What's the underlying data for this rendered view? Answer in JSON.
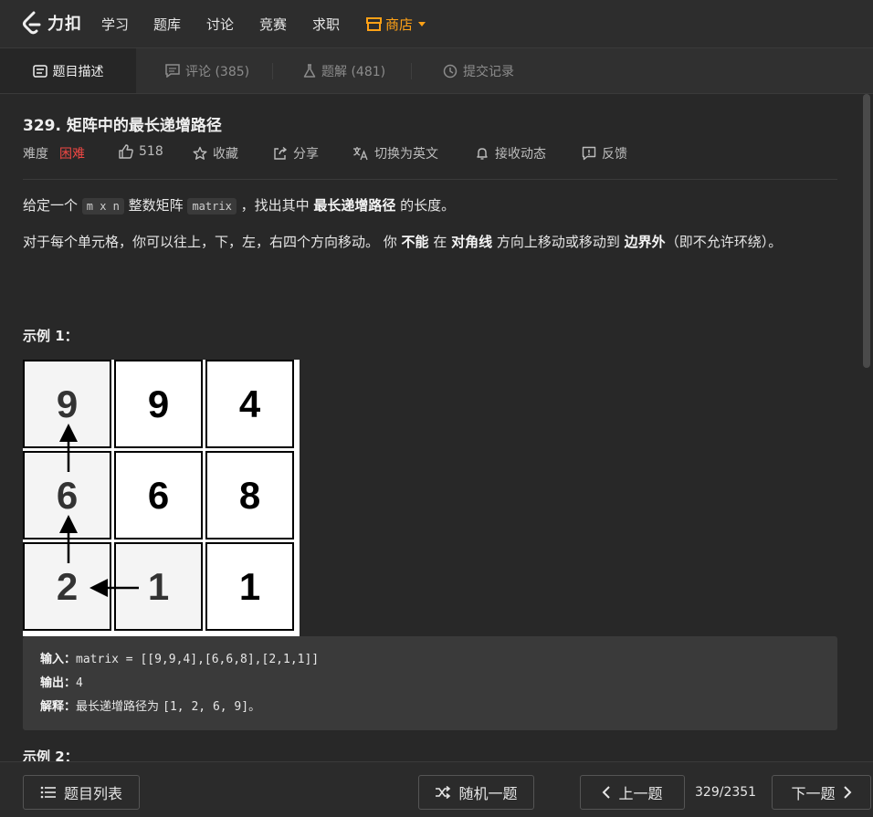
{
  "nav": {
    "logo_text": "力扣",
    "items": [
      "学习",
      "题库",
      "讨论",
      "竞赛",
      "求职"
    ],
    "shop": "商店"
  },
  "tabs": [
    {
      "label": "题目描述"
    },
    {
      "label": "评论 (385)"
    },
    {
      "label": "题解 (481)"
    },
    {
      "label": "提交记录"
    }
  ],
  "problem": {
    "title": "329. 矩阵中的最长递增路径",
    "difficulty_label": "难度",
    "difficulty": "困难",
    "likes": "518",
    "collect": "收藏",
    "share": "分享",
    "switch_lang": "切换为英文",
    "subscribe": "接收动态",
    "feedback": "反馈"
  },
  "description": {
    "p1_a": "给定一个 ",
    "p1_code1": "m x n",
    "p1_b": " 整数矩阵 ",
    "p1_code2": "matrix",
    "p1_c": " ，找出其中 ",
    "p1_bold": "最长递增路径",
    "p1_d": " 的长度。",
    "p2_a": "对于每个单元格，你可以往上，下，左，右四个方向移动。 你 ",
    "p2_b1": "不能",
    "p2_c": " 在 ",
    "p2_b2": "对角线",
    "p2_d": " 方向上移动或移动到 ",
    "p2_b3": "边界外",
    "p2_e": "（即不允许环绕）。"
  },
  "example1": {
    "label": "示例 1：",
    "matrix": [
      [
        "9",
        "9",
        "4"
      ],
      [
        "6",
        "6",
        "8"
      ],
      [
        "2",
        "1",
        "1"
      ]
    ],
    "input_label": "输入：",
    "input_value": "matrix = [[9,9,4],[6,6,8],[2,1,1]]",
    "output_label": "输出：",
    "output_value": "4",
    "explain_label": "解释：",
    "explain_text": "最长递增路径为 ",
    "explain_value": "[1, 2, 6, 9]",
    "explain_end": "。"
  },
  "example2": {
    "label": "示例 2："
  },
  "bottom": {
    "problem_list": "题目列表",
    "random": "随机一题",
    "prev": "上一题",
    "counter": "329/2351",
    "next": "下一题"
  }
}
